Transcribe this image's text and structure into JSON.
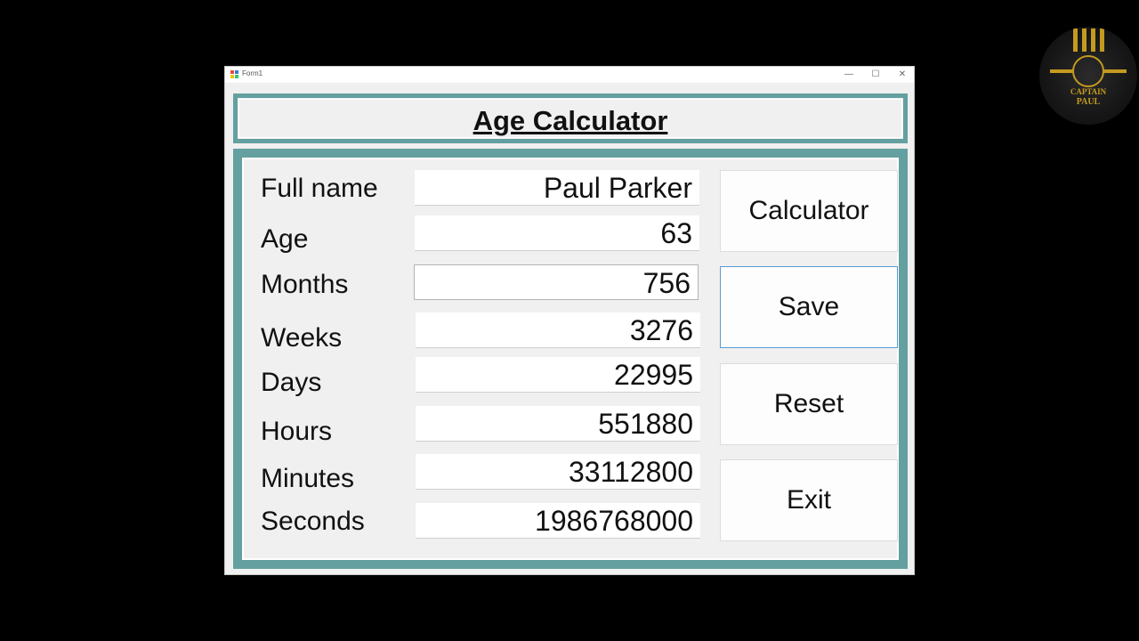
{
  "window": {
    "title": "Form1",
    "controls": {
      "minimize": "—",
      "maximize": "☐",
      "close": "✕"
    }
  },
  "header": {
    "title": "Age Calculator"
  },
  "fields": [
    {
      "label": "Full name",
      "value": "Paul Parker"
    },
    {
      "label": "Age",
      "value": "63"
    },
    {
      "label": "Months",
      "value": "756"
    },
    {
      "label": "Weeks",
      "value": "3276"
    },
    {
      "label": "Days",
      "value": "22995"
    },
    {
      "label": "Hours",
      "value": "551880"
    },
    {
      "label": "Minutes",
      "value": "33112800"
    },
    {
      "label": "Seconds",
      "value": "1986768000"
    }
  ],
  "buttons": {
    "calculator": "Calculator",
    "save": "Save",
    "reset": "Reset",
    "exit": "Exit"
  },
  "logo": {
    "line1": "CAPTAIN",
    "line2": "PAUL"
  },
  "colors": {
    "panel_border": "#64a0a0",
    "background": "#000000",
    "logo_gold": "#c49a1f"
  }
}
